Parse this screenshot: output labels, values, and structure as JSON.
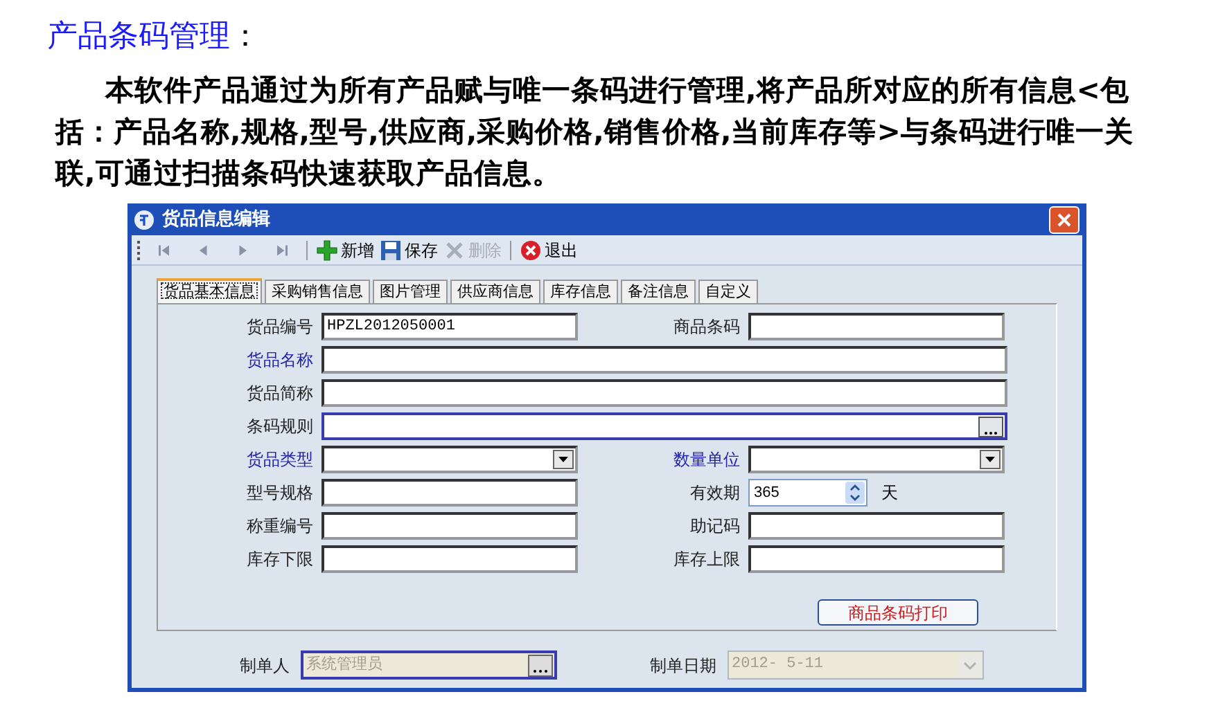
{
  "slide": {
    "title": "产品条码管理",
    "title_colon": "：",
    "body": "本软件产品通过为所有产品赋与唯一条码进行管理,将产品所对应的所有信息<包括：产品名称,规格,型号,供应商,采购价格,销售价格,当前库存等>与条码进行唯一关联,可通过扫描条码快速获取产品信息。"
  },
  "window": {
    "title": "货品信息编辑"
  },
  "toolbar": [
    {
      "kind": "first"
    },
    {
      "kind": "prev"
    },
    {
      "kind": "next"
    },
    {
      "kind": "last"
    },
    {
      "kind": "add",
      "label": "新增",
      "disabled": false
    },
    {
      "kind": "save",
      "label": "保存",
      "disabled": false
    },
    {
      "kind": "delete",
      "label": "删除",
      "disabled": true
    },
    {
      "kind": "exit",
      "label": "退出",
      "disabled": false
    }
  ],
  "tabs": [
    {
      "label": "货品基本信息",
      "selected": true
    },
    {
      "label": "采购销售信息",
      "selected": false
    },
    {
      "label": "图片管理",
      "selected": false
    },
    {
      "label": "供应商信息",
      "selected": false
    },
    {
      "label": "库存信息",
      "selected": false
    },
    {
      "label": "备注信息",
      "selected": false
    },
    {
      "label": "自定义",
      "selected": false
    }
  ],
  "fields": [
    {
      "label": "货品编号",
      "required": false,
      "kind": "text",
      "value": "HPZL2012050001",
      "wide": false
    },
    {
      "label": "商品条码",
      "required": false,
      "kind": "text",
      "wide": false
    },
    {
      "label": "货品名称",
      "required": true,
      "kind": "text",
      "wide": true
    },
    {
      "label": "货品简称",
      "required": false,
      "kind": "text",
      "wide": true
    },
    {
      "label": "条码规则",
      "required": false,
      "kind": "browse",
      "wide": true
    },
    {
      "label": "货品类型",
      "required": true,
      "kind": "combo",
      "wide": false
    },
    {
      "label": "数量单位",
      "required": true,
      "kind": "combo",
      "wide": false
    },
    {
      "label": "型号规格",
      "required": false,
      "kind": "text",
      "wide": false
    },
    {
      "label": "有效期",
      "required": false,
      "kind": "spin",
      "value": "365",
      "unit": "天",
      "wide": false
    },
    {
      "label": "称重编号",
      "required": false,
      "kind": "text",
      "wide": false
    },
    {
      "label": "助记码",
      "required": false,
      "kind": "text",
      "wide": false
    },
    {
      "label": "库存下限",
      "required": false,
      "kind": "text",
      "wide": false
    },
    {
      "label": "库存上限",
      "required": false,
      "kind": "text",
      "wide": false
    }
  ],
  "print_button": "商品条码打印",
  "footer": [
    {
      "label": "制单人",
      "kind": "browse",
      "value": "系统管理员",
      "disabled": true
    },
    {
      "label": "制单日期",
      "kind": "date",
      "value": "2012- 5-11",
      "disabled": true
    }
  ]
}
